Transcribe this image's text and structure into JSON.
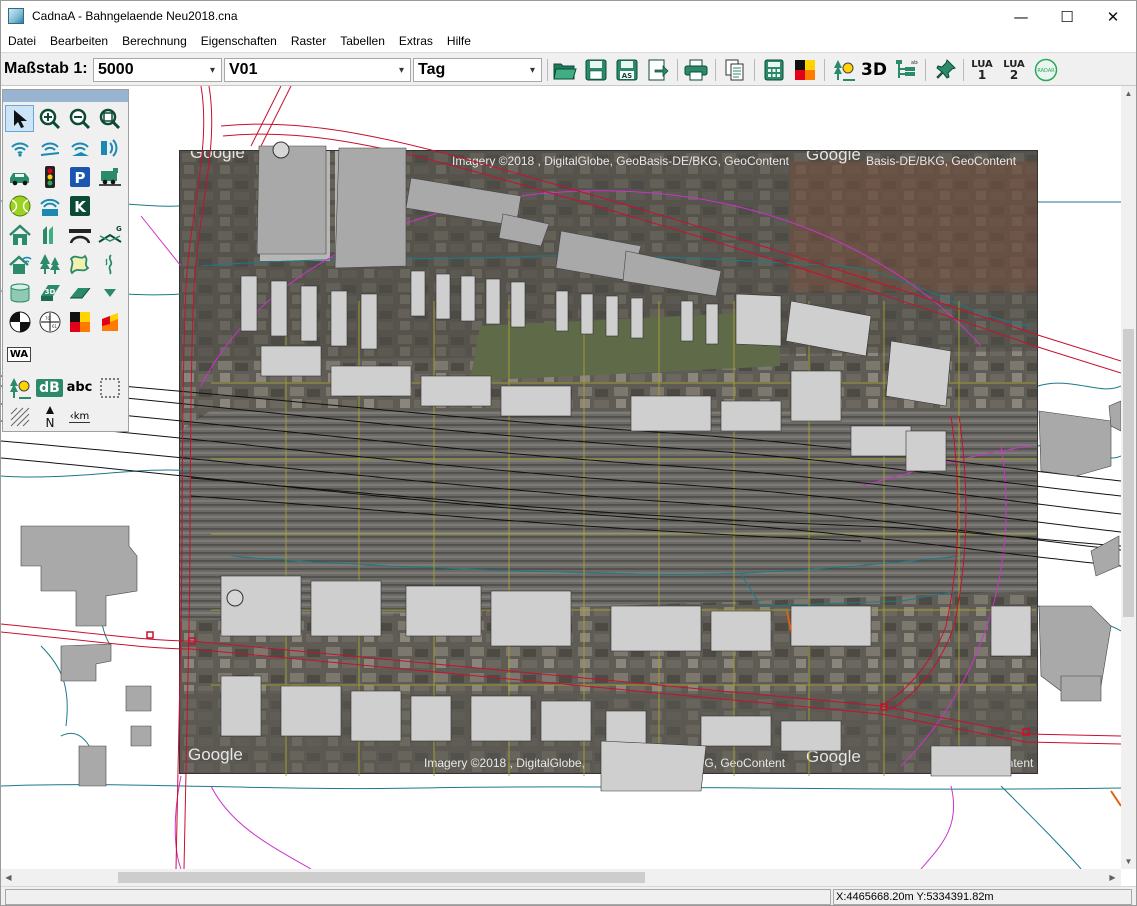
{
  "window": {
    "title": "CadnaA - Bahngelaende Neu2018.cna",
    "min_glyph": "—",
    "max_glyph": "☐",
    "close_glyph": "✕"
  },
  "menu": [
    "Datei",
    "Bearbeiten",
    "Berechnung",
    "Eigenschaften",
    "Raster",
    "Tabellen",
    "Extras",
    "Hilfe"
  ],
  "toolbar": {
    "scale_label": "Maßstab 1:",
    "scale_value": "5000",
    "variant_value": "V01",
    "period_value": "Tag",
    "btn_3d": "3D",
    "lua1_top": "LUA",
    "lua1_bottom": "1",
    "lua2_top": "LUA",
    "lua2_bottom": "2",
    "radar_label": "RADAR",
    "dropdown_arrow": "▾"
  },
  "palette": {
    "wa_label": "WA",
    "db_label": "dB",
    "abc_label": "abc",
    "km_label": "km",
    "north_label": "N",
    "k_label": "K",
    "p_label": "P",
    "d3_label": "3D",
    "g_label": "G"
  },
  "aerial": {
    "caption_top": "Imagery ©2018 , DigitalGlobe, GeoBasis-DE/BKG, GeoContent",
    "caption_top_2": "Basis-DE/BKG, GeoContent",
    "caption_bottom": "Imagery ©2018 , DigitalGlobe,",
    "caption_bottom_2": "/BKG, GeoContent",
    "caption_bottom_3": "ontent",
    "google_1": "Google",
    "google_2": "Google",
    "google_3": "Google",
    "google_4": "Google",
    "google_5": "Google"
  },
  "status": {
    "coords": "X:4465668.20m Y:5334391.82m"
  },
  "colors": {
    "accent_blue": "#99b4d1",
    "road_red": "#c8102e",
    "contour_teal": "#1a7a8a",
    "rail_black": "#111111",
    "grid_olive": "#a8a232",
    "magenta": "#cc33cc"
  }
}
